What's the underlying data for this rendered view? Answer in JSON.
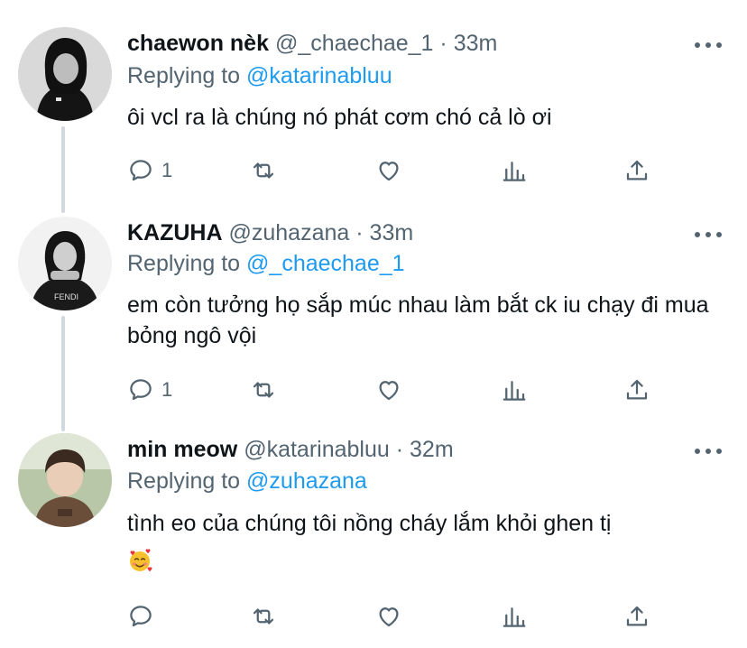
{
  "tweets": [
    {
      "name": "chaewon nèk",
      "handle": "@_chaechae_1",
      "separator": "·",
      "time": "33m",
      "replying_prefix": "Replying to",
      "replying_to": "@katarinabluu",
      "text": "ôi vcl ra là chúng nó phát cơm chó cả lò ơi",
      "reply_count": "1",
      "retweet_count": "",
      "like_count": ""
    },
    {
      "name": "KAZUHA",
      "handle": "@zuhazana",
      "separator": "·",
      "time": "33m",
      "replying_prefix": "Replying to",
      "replying_to": "@_chaechae_1",
      "text": "em còn tưởng họ sắp múc nhau làm bắt ck iu chạy đi mua bỏng ngô vội",
      "reply_count": "1",
      "retweet_count": "",
      "like_count": ""
    },
    {
      "name": "min meow",
      "handle": "@katarinabluu",
      "separator": "·",
      "time": "32m",
      "replying_prefix": "Replying to",
      "replying_to": "@zuhazana",
      "text": "tình eo của chúng tôi nồng cháy lắm khỏi ghen tị",
      "emoji": "smiling-face-with-hearts",
      "reply_count": "",
      "retweet_count": "",
      "like_count": ""
    }
  ],
  "colors": {
    "text": "#0f1419",
    "secondary": "#536471",
    "link": "#1d9bf0",
    "thread_line": "#cfd9de"
  }
}
